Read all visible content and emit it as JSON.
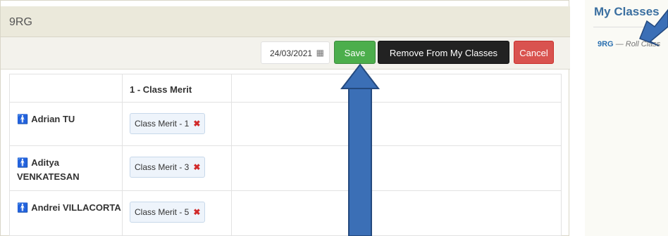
{
  "class_panel": {
    "title": "9RG"
  },
  "toolbar": {
    "date": "24/03/2021",
    "save_label": "Save",
    "remove_label": "Remove From My Classes",
    "cancel_label": "Cancel"
  },
  "grid": {
    "header_blank": "",
    "merit_header": "1 - Class Merit",
    "rows": [
      {
        "name": "Adrian TU",
        "merit": "Class Merit - 1"
      },
      {
        "name": "Aditya VENKATESAN",
        "merit": "Class Merit - 3"
      },
      {
        "name": "Andrei VILLACORTA",
        "merit": "Class Merit - 5"
      }
    ]
  },
  "sidebar": {
    "title": "My Classes",
    "item_code": "9RG",
    "item_desc": "— Roll Class"
  },
  "colors": {
    "save": "#4cae4c",
    "remove": "#222222",
    "cancel": "#d9534f",
    "arrow": "#3b6fb6"
  },
  "icons": {
    "student": "person-icon",
    "calendar": "calendar-icon",
    "remove": "remove-x-icon"
  }
}
